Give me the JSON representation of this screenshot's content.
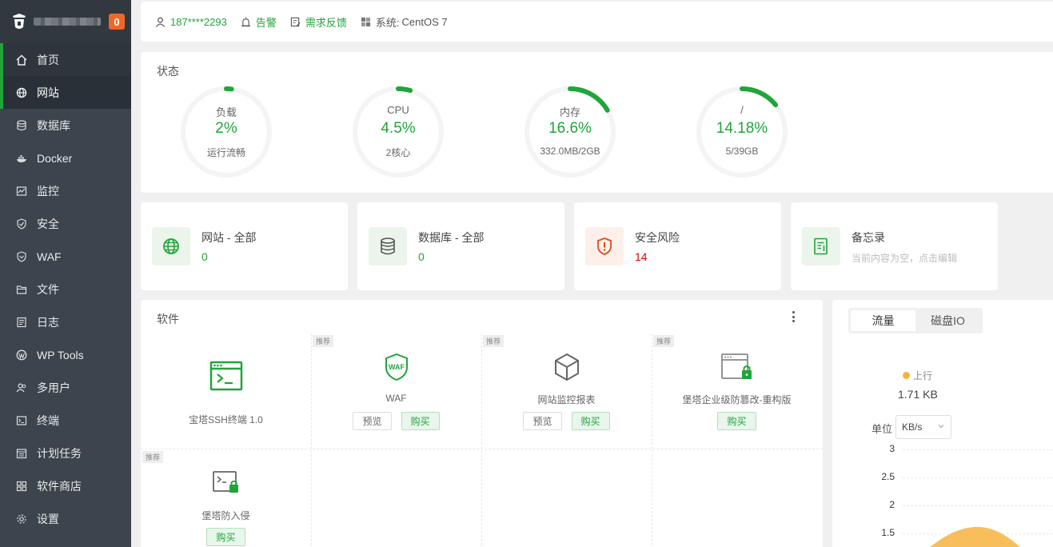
{
  "sidebar": {
    "badge": "0",
    "items": [
      {
        "label": "首页",
        "icon": "home-icon"
      },
      {
        "label": "网站",
        "icon": "globe-icon"
      },
      {
        "label": "数据库",
        "icon": "database-icon"
      },
      {
        "label": "Docker",
        "icon": "docker-icon"
      },
      {
        "label": "监控",
        "icon": "monitor-icon"
      },
      {
        "label": "安全",
        "icon": "shield-icon"
      },
      {
        "label": "WAF",
        "icon": "waf-shield-icon"
      },
      {
        "label": "文件",
        "icon": "folder-icon"
      },
      {
        "label": "日志",
        "icon": "log-icon"
      },
      {
        "label": "WP Tools",
        "icon": "wordpress-icon"
      },
      {
        "label": "多用户",
        "icon": "users-icon"
      },
      {
        "label": "终端",
        "icon": "terminal-icon"
      },
      {
        "label": "计划任务",
        "icon": "calendar-icon"
      },
      {
        "label": "软件商店",
        "icon": "apps-icon"
      },
      {
        "label": "设置",
        "icon": "gear-icon"
      }
    ]
  },
  "topbar": {
    "user": "187****2293",
    "alarm": "告警",
    "feedback": "需求反馈",
    "system_label": "系统:",
    "system_value": "CentOS 7"
  },
  "status": {
    "title": "状态",
    "gauges": [
      {
        "name": "负载",
        "value": "2%",
        "sub": "运行流畅",
        "fraction": 0.02
      },
      {
        "name": "CPU",
        "value": "4.5%",
        "sub": "2核心",
        "fraction": 0.045
      },
      {
        "name": "内存",
        "value": "16.6%",
        "sub": "332.0MB/2GB",
        "fraction": 0.166
      },
      {
        "name": "/",
        "value": "14.18%",
        "sub": "5/39GB",
        "fraction": 0.1418
      }
    ]
  },
  "cards": [
    {
      "title": "网站 - 全部",
      "value": "0",
      "icon": "globe-icon"
    },
    {
      "title": "数据库 - 全部",
      "value": "0",
      "icon": "database-icon"
    },
    {
      "title": "安全风险",
      "value": "14",
      "icon": "security-risk-icon"
    },
    {
      "title": "备忘录",
      "sub": "当前内容为空，点击编辑",
      "icon": "memo-icon"
    }
  ],
  "software": {
    "title": "软件",
    "recommend_tag": "推荐",
    "items": [
      {
        "name": "宝塔SSH终端 1.0",
        "icon": "ssh-terminal-icon"
      },
      {
        "name": "WAF",
        "icon": "waf-icon",
        "preview": "预览",
        "buy": "购买"
      },
      {
        "name": "网站监控报表",
        "icon": "cube-icon",
        "preview": "预览",
        "buy": "购买"
      },
      {
        "name": "堡塔企业级防篡改-重构版",
        "icon": "tamper-proof-icon",
        "buy": "购买"
      },
      {
        "name": "堡塔防入侵",
        "icon": "intrusion-icon",
        "buy": "购买"
      }
    ]
  },
  "traffic": {
    "tabs": [
      "流量",
      "磁盘IO"
    ],
    "up_label": "上行",
    "up_value": "1.71 KB",
    "unit_label": "单位",
    "unit_value": "KB/s",
    "colors": {
      "up": "#f7b33e"
    }
  },
  "chart_data": {
    "type": "area",
    "y_ticks": [
      "3",
      "2.5",
      "2",
      "1.5"
    ],
    "series": [
      {
        "name": "上行",
        "color": "#f7b33e"
      }
    ]
  }
}
